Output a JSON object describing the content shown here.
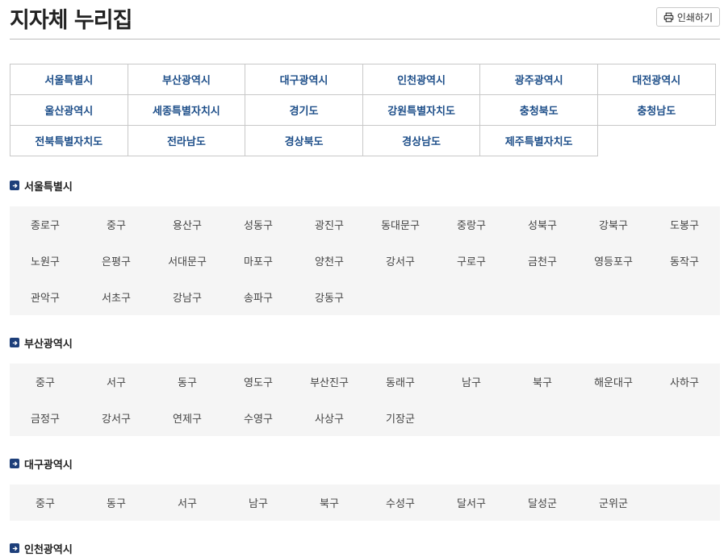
{
  "header": {
    "title": "지자체 누리집",
    "print_label": "인쇄하기"
  },
  "regions": [
    [
      "서울특별시",
      "부산광역시",
      "대구광역시",
      "인천광역시",
      "광주광역시",
      "대전광역시"
    ],
    [
      "울산광역시",
      "세종특별자치시",
      "경기도",
      "강원특별자치도",
      "충청북도",
      "충청남도"
    ],
    [
      "전북특별자치도",
      "전라남도",
      "경상북도",
      "경상남도",
      "제주특별자치도"
    ]
  ],
  "sections": [
    {
      "name": "서울특별시",
      "districts": [
        "종로구",
        "중구",
        "용산구",
        "성동구",
        "광진구",
        "동대문구",
        "중랑구",
        "성북구",
        "강북구",
        "도봉구",
        "노원구",
        "은평구",
        "서대문구",
        "마포구",
        "양천구",
        "강서구",
        "구로구",
        "금천구",
        "영등포구",
        "동작구",
        "관악구",
        "서초구",
        "강남구",
        "송파구",
        "강동구"
      ]
    },
    {
      "name": "부산광역시",
      "districts": [
        "중구",
        "서구",
        "동구",
        "영도구",
        "부산진구",
        "동래구",
        "남구",
        "북구",
        "해운대구",
        "사하구",
        "금정구",
        "강서구",
        "연제구",
        "수영구",
        "사상구",
        "기장군"
      ]
    },
    {
      "name": "대구광역시",
      "districts": [
        "중구",
        "동구",
        "서구",
        "남구",
        "북구",
        "수성구",
        "달서구",
        "달성군",
        "군위군"
      ]
    },
    {
      "name": "인천광역시",
      "districts": []
    }
  ]
}
